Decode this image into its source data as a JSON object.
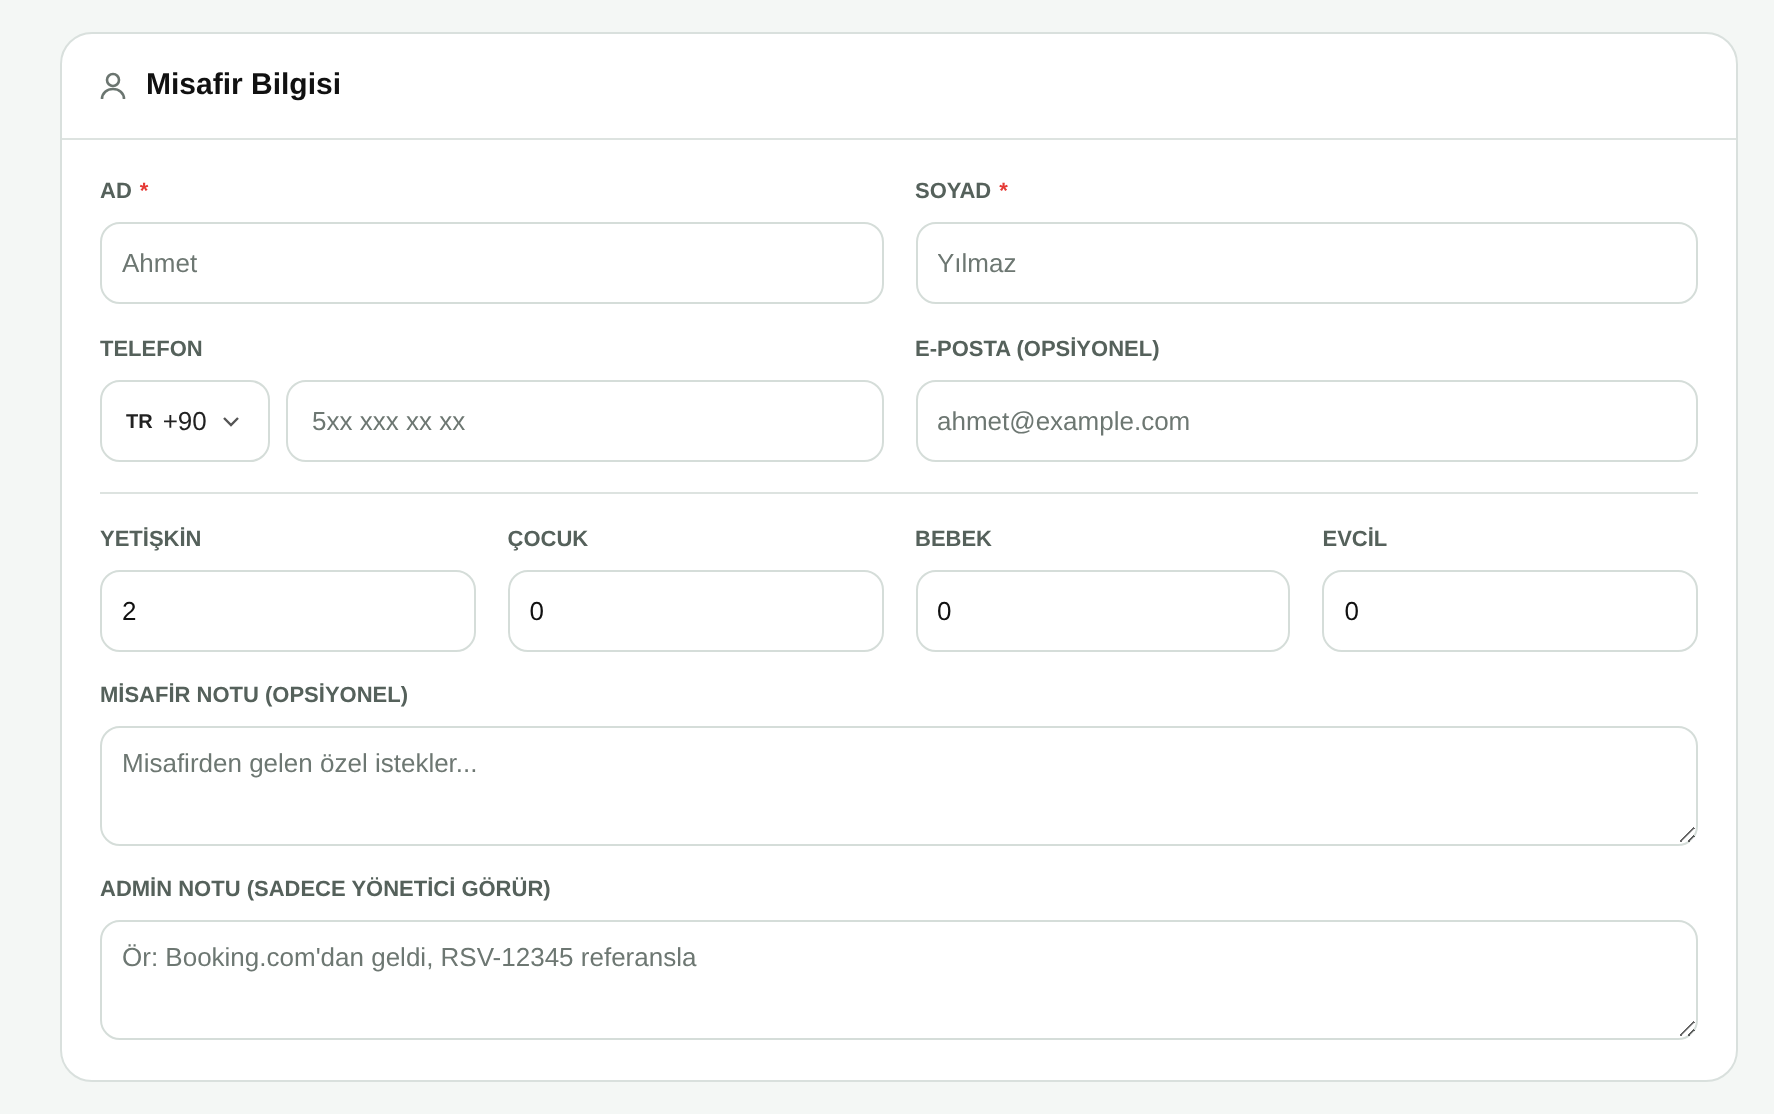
{
  "card": {
    "title": "Misafir Bilgisi"
  },
  "name_fields": [
    {
      "label": "AD",
      "required_mark": "*",
      "placeholder": "Ahmet"
    },
    {
      "label": "SOYAD",
      "required_mark": "*",
      "placeholder": "Yılmaz"
    }
  ],
  "phone": {
    "label": "TELEFON",
    "country": "TR",
    "dial_code": "+90",
    "placeholder": "5xx xxx xx xx"
  },
  "email": {
    "label": "E-POSTA (OPSİYONEL)",
    "placeholder": "ahmet@example.com"
  },
  "counts": [
    {
      "label": "YETİŞKİN",
      "value": "2"
    },
    {
      "label": "ÇOCUK",
      "value": "0"
    },
    {
      "label": "BEBEK",
      "value": "0"
    },
    {
      "label": "EVCİL",
      "value": "0"
    }
  ],
  "notes": [
    {
      "label": "MİSAFİR NOTU (OPSİYONEL)",
      "placeholder": "Misafirden gelen özel istekler..."
    },
    {
      "label": "ADMİN NOTU (SADECE YÖNETİCİ GÖRÜR)",
      "placeholder": "Ör: Booking.com'dan geldi, RSV-12345 referansla"
    }
  ]
}
